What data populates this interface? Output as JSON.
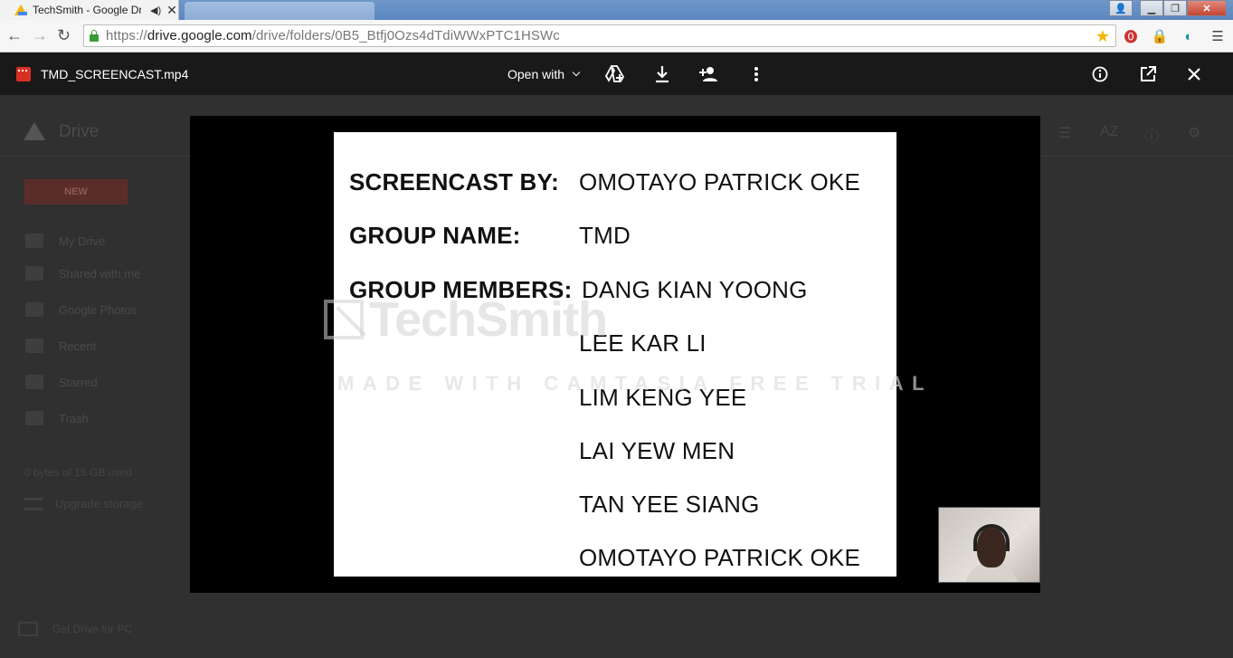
{
  "browser": {
    "tab_title": "TechSmith - Google Dr",
    "audio_icon": "speaker-icon",
    "url_prefix": "https://",
    "url_host": "drive.google.com",
    "url_path": "/drive/folders/0B5_Btfj0Ozs4dTdiWWxPTC1HSWc",
    "window_controls": [
      "minimize",
      "maximize",
      "close"
    ]
  },
  "drive": {
    "title": "Drive",
    "new_label": "NEW",
    "nav": [
      {
        "label": "My Drive",
        "icon": "folder-icon"
      },
      {
        "label": "Shared with me",
        "icon": "people-icon"
      },
      {
        "label": "Google Photos",
        "icon": "photos-icon"
      },
      {
        "label": "Recent",
        "icon": "clock-icon"
      },
      {
        "label": "Starred",
        "icon": "star-icon"
      },
      {
        "label": "Trash",
        "icon": "trash-icon"
      }
    ],
    "quota": "0 bytes of 15 GB used",
    "upgrade": "Upgrade storage",
    "get_drive": "Get Drive for PC"
  },
  "viewer": {
    "file_name": "TMD_SCREENCAST.mp4",
    "open_with": "Open with",
    "icons": [
      "add-to-drive-icon",
      "download-icon",
      "share-icon",
      "more-vert-icon",
      "info-icon",
      "open-new-window-icon",
      "close-icon"
    ]
  },
  "slide": {
    "screencast_label": "SCREENCAST BY:",
    "screencast_value": "OMOTAYO PATRICK OKE",
    "group_name_label": "GROUP NAME:",
    "group_name_value": "TMD",
    "members_label": "GROUP MEMBERS:",
    "members": [
      "DANG KIAN YOONG",
      "LEE KAR LI",
      "LIM KENG YEE",
      "LAI YEW MEN",
      "TAN YEE SIANG",
      "OMOTAYO PATRICK OKE"
    ],
    "watermark_brand": "TechSmith",
    "watermark_text": "MADE WITH CAMTASIA FREE TRIAL"
  }
}
